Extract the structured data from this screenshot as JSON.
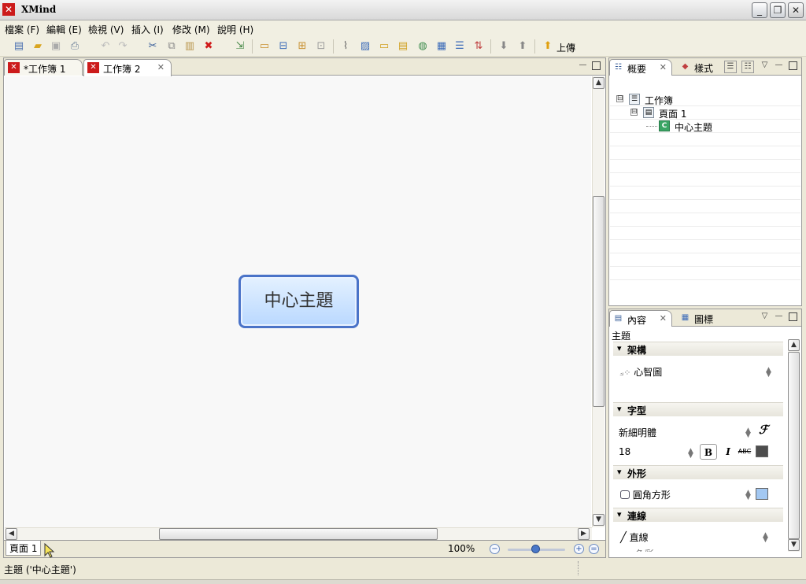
{
  "window": {
    "title": "XMind"
  },
  "menu": [
    "檔案 (F)",
    "編輯 (E)",
    "檢視 (V)",
    "插入 (I)",
    "修改 (M)",
    "說明 (H)"
  ],
  "toolbar": {
    "icons": [
      "new-icon",
      "open-icon",
      "save-icon",
      "print-icon",
      "undo-icon",
      "redo-icon",
      "cut-icon",
      "copy-icon",
      "paste-icon",
      "delete-icon",
      "export-icon",
      "insert-topic-icon",
      "insert-subtopic-icon",
      "insert-parent-icon",
      "detach-icon",
      "attachment-icon",
      "image-icon",
      "boundary-icon",
      "note-icon",
      "hyperlink-icon",
      "summary-icon",
      "relationship-icon",
      "marker-icon",
      "drill-down-icon",
      "drill-up-icon",
      "up-arrow-icon"
    ],
    "up_label": "上傳"
  },
  "editor": {
    "tabs": [
      {
        "label": "*工作簿 1"
      },
      {
        "label": "工作簿 2"
      }
    ],
    "central_topic": "中心主題",
    "sheet_tab": "頁面 1",
    "zoom": "100%"
  },
  "outline_panel": {
    "tabs": [
      "概要",
      "樣式"
    ],
    "tree": [
      {
        "label": "工作簿",
        "toggle": "⊟",
        "icon": "workbook-icon"
      },
      {
        "label": "頁面 1",
        "toggle": "⊟",
        "icon": "sheet-icon"
      },
      {
        "label": "中心主題",
        "icon": "central-topic-icon",
        "icon_glyph": "C"
      }
    ]
  },
  "properties_panel": {
    "tabs": [
      "內容",
      "圖標"
    ],
    "title": "主題",
    "sections": {
      "structure": {
        "header": "架構",
        "value": "心智圖"
      },
      "font": {
        "header": "字型",
        "family": "新細明體",
        "size": "18",
        "bold": "B",
        "italic": "I",
        "strike": "ABC",
        "color": "#4d4d4d"
      },
      "shape": {
        "header": "外形",
        "value": "圓角方形",
        "fill": "#a3c8f2"
      },
      "line": {
        "header": "連線",
        "value": "直線",
        "partial": "色彩"
      }
    }
  },
  "status": {
    "text": "主題 ('中心主題')"
  },
  "colors": {
    "topic_border": "#4a73c8",
    "topic_fill": "#b9d8ff",
    "brand_red": "#cc1b1b"
  }
}
